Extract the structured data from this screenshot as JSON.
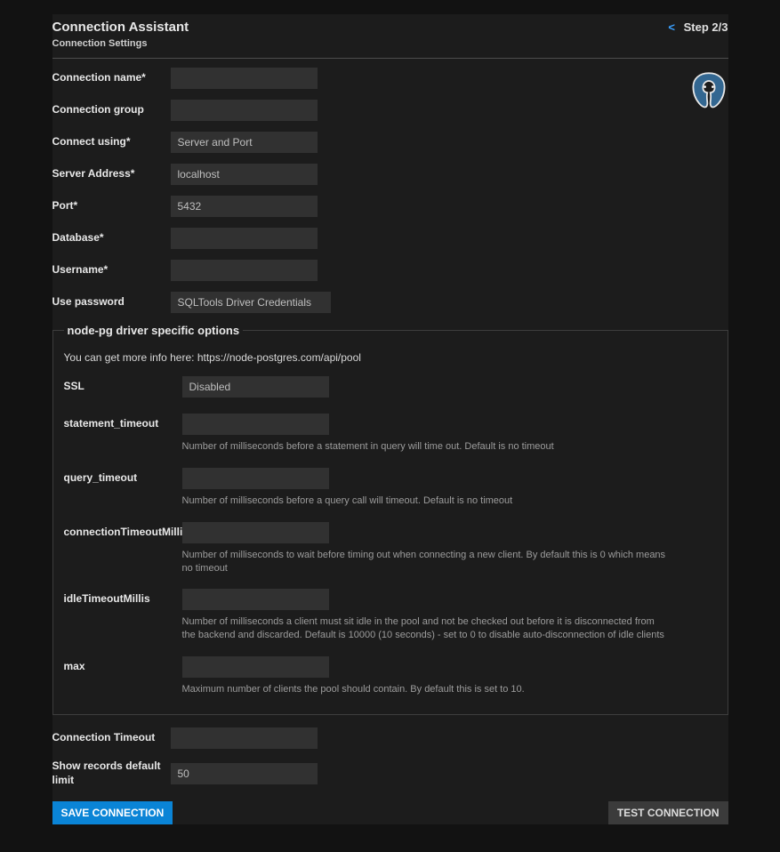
{
  "header": {
    "title": "Connection Assistant",
    "step_arrow": "<",
    "step_label": "Step 2/3",
    "subtitle": "Connection Settings"
  },
  "fields": {
    "connection_name": {
      "label": "Connection name*",
      "value": ""
    },
    "connection_group": {
      "label": "Connection group",
      "value": ""
    },
    "connect_using": {
      "label": "Connect using*",
      "value": "Server and Port"
    },
    "server_address": {
      "label": "Server Address*",
      "value": "localhost"
    },
    "port": {
      "label": "Port*",
      "value": "5432"
    },
    "database": {
      "label": "Database*",
      "value": ""
    },
    "username": {
      "label": "Username*",
      "value": ""
    },
    "use_password": {
      "label": "Use password",
      "value": "SQLTools Driver Credentials"
    },
    "connection_timeout": {
      "label": "Connection Timeout",
      "value": ""
    },
    "show_records_limit": {
      "label": "Show records default limit",
      "value": "50"
    }
  },
  "group": {
    "legend": "node-pg driver specific options",
    "info": "You can get more info here: https://node-postgres.com/api/pool",
    "ssl": {
      "label": "SSL",
      "value": "Disabled"
    },
    "statement_timeout": {
      "label": "statement_timeout",
      "value": "",
      "hint": "Number of milliseconds before a statement in query will time out. Default is no timeout"
    },
    "query_timeout": {
      "label": "query_timeout",
      "value": "",
      "hint": "Number of milliseconds before a query call will timeout. Default is no timeout"
    },
    "connectionTimeoutMillis": {
      "label": "connectionTimeoutMillis",
      "value": "",
      "hint": "Number of milliseconds to wait before timing out when connecting a new client. By default this is 0 which means no timeout"
    },
    "idleTimeoutMillis": {
      "label": "idleTimeoutMillis",
      "value": "",
      "hint": "Number of milliseconds a client must sit idle in the pool and not be checked out before it is disconnected from the backend and discarded. Default is 10000 (10 seconds) - set to 0 to disable auto-disconnection of idle clients"
    },
    "max": {
      "label": "max",
      "value": "",
      "hint": "Maximum number of clients the pool should contain. By default this is set to 10."
    }
  },
  "buttons": {
    "save": "SAVE CONNECTION",
    "test": "TEST CONNECTION"
  }
}
